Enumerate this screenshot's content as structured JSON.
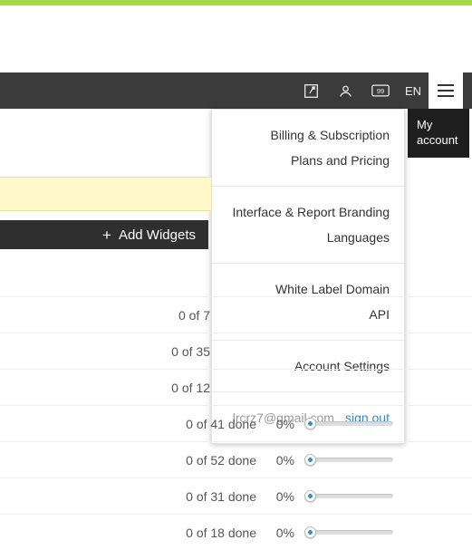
{
  "topbar": {
    "language": "EN"
  },
  "tooltip": "My account",
  "menu": {
    "section1": {
      "a": "Billing & Subscription",
      "b": "Plans and Pricing"
    },
    "section2": {
      "a": "Interface & Report Branding",
      "b": "Languages"
    },
    "section3": {
      "a": "White Label Domain",
      "b": "API"
    },
    "section4": {
      "a": "Account Settings"
    },
    "footer": {
      "email": "lrcrz7@gmail.com",
      "signout": "sign out"
    }
  },
  "widgets": {
    "add_label": "Add Widgets"
  },
  "rows": [
    {
      "status": "0 of 7",
      "pct": "",
      "slider": false
    },
    {
      "status": "0 of 35",
      "pct": "",
      "slider": false
    },
    {
      "status": "0 of 12",
      "pct": "",
      "slider": false
    },
    {
      "status": "0 of 41 done",
      "pct": "0%",
      "slider": true
    },
    {
      "status": "0 of 52 done",
      "pct": "0%",
      "slider": true
    },
    {
      "status": "0 of 31 done",
      "pct": "0%",
      "slider": true
    },
    {
      "status": "0 of 18 done",
      "pct": "0%",
      "slider": true
    }
  ]
}
